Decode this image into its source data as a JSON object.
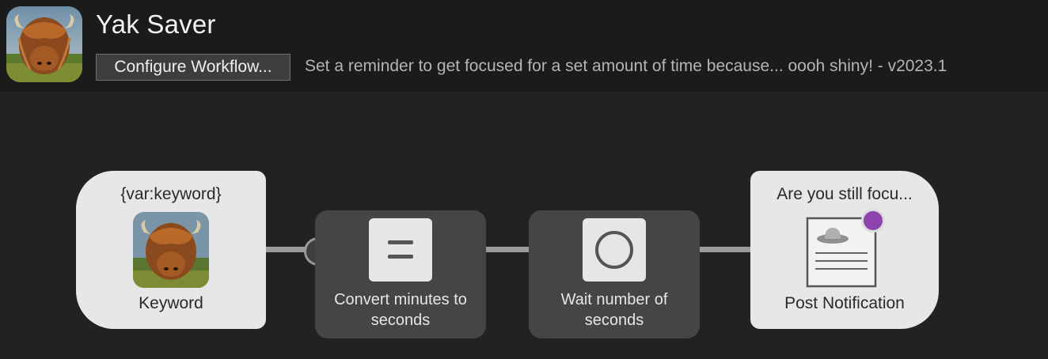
{
  "header": {
    "title": "Yak Saver",
    "configure_label": "Configure Workflow...",
    "description": "Set a reminder to get focused for a set amount of time because... oooh shiny! - v2023.1"
  },
  "nodes": [
    {
      "type": "trigger",
      "top_label": "{var:keyword}",
      "bottom_label": "Keyword",
      "icon": "highland-cow-image"
    },
    {
      "type": "utility",
      "label": "Convert minutes to seconds",
      "icon": "equals-icon"
    },
    {
      "type": "utility",
      "label": "Wait number of seconds",
      "icon": "circle-icon"
    },
    {
      "type": "output",
      "top_label": "Are you still focu...",
      "bottom_label": "Post Notification",
      "icon": "notification-document-icon"
    }
  ],
  "colors": {
    "background": "#222222",
    "header": "#1b1b1b",
    "node_light": "#e7e7e7",
    "node_dark": "#454545",
    "wire": "#9a9a9a",
    "badge": "#8e44ad"
  }
}
